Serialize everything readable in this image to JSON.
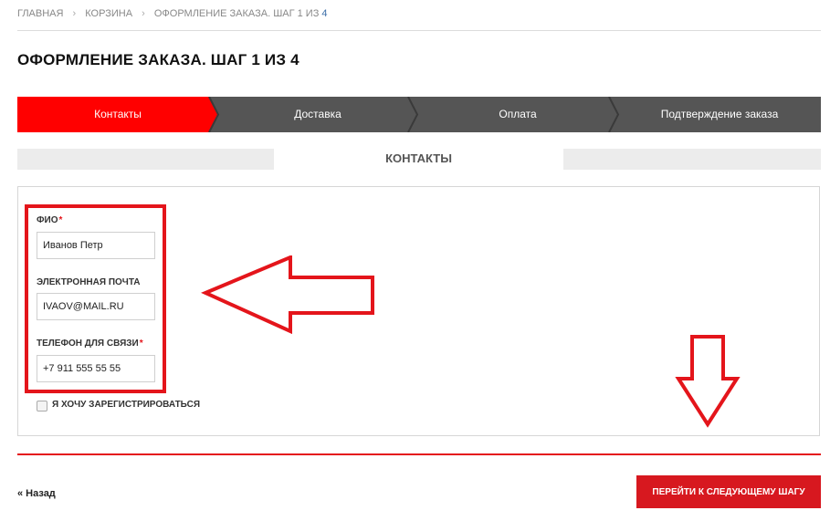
{
  "breadcrumb": {
    "items": [
      "ГЛАВНАЯ",
      "КОРЗИНА"
    ],
    "current_text": "ОФОРМЛЕНИЕ ЗАКАЗА. ШАГ 1 ИЗ",
    "current_num": "4",
    "separator": "›"
  },
  "page_title": "ОФОРМЛЕНИЕ ЗАКАЗА. ШАГ 1 ИЗ 4",
  "steps": [
    {
      "label": "Контакты",
      "active": true
    },
    {
      "label": "Доставка",
      "active": false
    },
    {
      "label": "Оплата",
      "active": false
    },
    {
      "label": "Подтверждение заказа",
      "active": false
    }
  ],
  "section_title": "КОНТАКТЫ",
  "form": {
    "fio": {
      "label": "ФИО",
      "required_mark": "*",
      "value": "Иванов Петр"
    },
    "email": {
      "label": "ЭЛЕКТРОННАЯ ПОЧТА",
      "value": "IVAOV@MAIL.RU"
    },
    "phone": {
      "label": "ТЕЛЕФОН ДЛЯ СВЯЗИ",
      "required_mark": "*",
      "value": "+7 911 555 55 55"
    },
    "register_checkbox": {
      "label": "Я ХОЧУ ЗАРЕГИСТРИРОВАТЬСЯ",
      "checked": false
    }
  },
  "footer": {
    "back_label": "« Назад",
    "next_label": "ПЕРЕЙТИ К СЛЕДУЮЩЕМУ ШАГУ"
  },
  "colors": {
    "accent": "#e4151b",
    "button": "#d7181f",
    "step_inactive": "#555555",
    "link_num": "#3b6ea8"
  }
}
